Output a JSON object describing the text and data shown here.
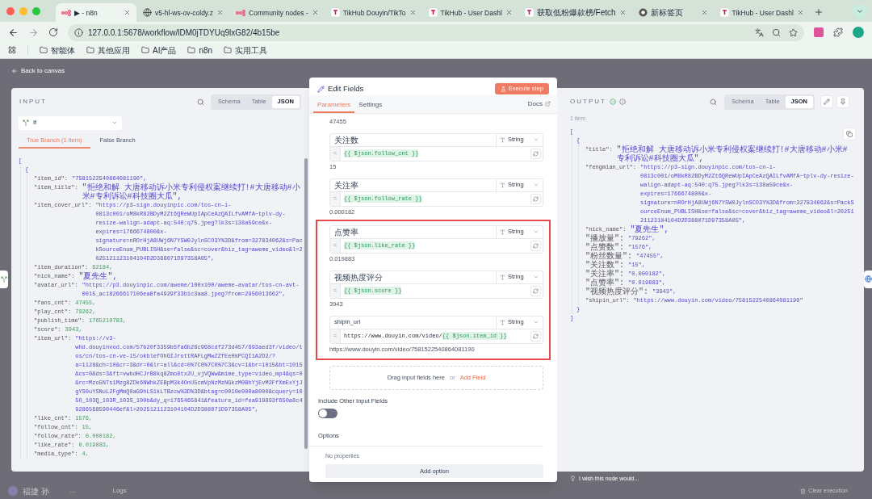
{
  "browser": {
    "tabs": [
      {
        "kind": "n8n",
        "title": "▶ - n8n",
        "selected": true
      },
      {
        "kind": "globe",
        "title": "v5-hl-ws-ov-coldy.z",
        "selected": false
      },
      {
        "kind": "n8n",
        "title": "Community nodes -",
        "selected": false
      },
      {
        "kind": "tikhub",
        "title": "TikHub Douyin/TikTo",
        "selected": false
      },
      {
        "kind": "tikhub",
        "title": "TikHub - User Dashl",
        "selected": false
      },
      {
        "kind": "tikhub",
        "title": "获取低粉爆款榜/Fetch",
        "selected": false
      },
      {
        "kind": "chrome",
        "title": "新标签页",
        "selected": false
      },
      {
        "kind": "tikhub",
        "title": "TikHub - User Dashl",
        "selected": false
      }
    ],
    "url": "127.0.0.1:5678/workflow/lDM0jTDYUq9lxG82/4b15be",
    "bookmarks": [
      "智能体",
      "其他应用",
      "AI产品",
      "n8n",
      "实用工具"
    ]
  },
  "back_link": "Back to canvas",
  "input": {
    "title": "INPUT",
    "views": [
      {
        "label": "Schema",
        "selected": false
      },
      {
        "label": "Table",
        "selected": false
      },
      {
        "label": "JSON",
        "selected": true
      }
    ],
    "node_select": "If",
    "branches": [
      {
        "label": "True Branch (1 item)",
        "selected": true
      },
      {
        "label": "False Branch",
        "selected": false
      }
    ],
    "json": {
      "open": "[",
      "items": [
        {
          "open": "{",
          "entries": [
            {
              "key": "\"item_id\":",
              "value": "\"7581522540864081190\",",
              "kind": "string"
            },
            {
              "key": "\"item_title\":",
              "value": "\"拒绝和解 大唐移动诉小米专利侵权案继续打!#大唐移动#小米#专利诉讼#科技圈大瓜\",",
              "kind": "string"
            },
            {
              "key": "\"item_cover_url\":",
              "value": "\"https://p3-sign.douyinpic.com/tos-cn-i-0813c001/oM8kR82BDyM2Zt6QReWUpIApCeAzQAILfvAMfA~tplv-dy-resize-walign-adapt-aq:540:q75.jpeg?lk3s=138a59ce&x-expires=1766674800&x-signature=nROrHjA8UWj6N7YSW0JylnSCO3Y%3D&from=327834062&s=PackSourceEnum_PUBLISH&se=false&sc=cover&biz_tag=aweme_video&l=2025121123104104D2D388071D97358A05\",",
              "kind": "string"
            },
            {
              "key": "\"item_duration\":",
              "value": "62184,",
              "kind": "number"
            },
            {
              "key": "\"nick_name\":",
              "value": "\"夏先生\",",
              "kind": "string"
            },
            {
              "key": "\"avatar_url\":",
              "value": "\"https://p3.douyinpic.com/aweme/100x100/aweme-avatar/tos-cn-avt-0015_ac18266617106ea8fa4929f33b1c3aa8.jpeg?from=2956013662\",",
              "kind": "string"
            },
            {
              "key": "\"fans_cnt\":",
              "value": "47455,",
              "kind": "number"
            },
            {
              "key": "\"play_cnt\":",
              "value": "79262,",
              "kind": "number"
            },
            {
              "key": "\"publish_time\":",
              "value": "1765210783,",
              "kind": "number"
            },
            {
              "key": "\"score\":",
              "value": "3943,",
              "kind": "number"
            },
            {
              "key": "\"item_url\":",
              "value": "\"https://v3-whd.douyinvod.com/57b20f3359b5fa6b28c968cdf273d457/693aed3f/video/tos/cn/tos-cn-ve-15/okblefOhGIJrottRAFLgMwZZfEeHkPCQI1A2D2/?a=1128&ch=10&cr=3&dr=0&lr=all&cd=0%7C0%7C0%7C3&cv=1&br=1015&bt=1015&cs=0&ds=3&ft=vwbdHCJrB8kq8Zmo8tx2U_vjVQWw&mime_type=video_mp4&qs=0&rc=Mzo5NTs1Mzg8ZDk6NWhkZEBpM3k4OnU5cmVpNzMzNGkzM0BhYjEvM2FfXmExYjJgYS0uYSNuL2FgMmQ0aG9hLS1kLTBzcw%3D%3D&btag=c0010e000a8000&cquery=105O_103Q_103R_103S_100b&dy_q=1765465841&feature_id=fea919893f650a8c49286568590446ef&l=2025121123104104D2D388071D97358A05\",",
              "kind": "string"
            },
            {
              "key": "\"like_cnt\":",
              "value": "1576,",
              "kind": "number"
            },
            {
              "key": "\"follow_cnt\":",
              "value": "15,",
              "kind": "number"
            },
            {
              "key": "\"follow_rate\":",
              "value": "0.000182,",
              "kind": "number"
            },
            {
              "key": "\"like_rate\":",
              "value": "0.019883,",
              "kind": "number"
            },
            {
              "key": "\"media_type\":",
              "value": "4,",
              "kind": "number"
            }
          ]
        }
      ]
    }
  },
  "editor": {
    "title": "Edit Fields",
    "execute_button": "Execute step",
    "tabs": [
      {
        "label": "Parameters",
        "selected": true
      },
      {
        "label": "Settings",
        "selected": false
      }
    ],
    "docs_link": "Docs",
    "fields": [
      {
        "kind": "partial",
        "result": "47455"
      },
      {
        "kind": "field",
        "name": "关注数",
        "type": "String",
        "prefix": "=",
        "expression": [
          {
            "kind": "expression",
            "text": "{{ $json.follow_cnt }}"
          }
        ],
        "result": "15",
        "highlighted": false
      },
      {
        "kind": "field",
        "name": "关注率",
        "type": "String",
        "prefix": "=",
        "expression": [
          {
            "kind": "expression",
            "text": "{{ $json.follow_rate }}"
          }
        ],
        "result": "0.000182",
        "highlighted": false
      },
      {
        "kind": "field",
        "name": "点赞率",
        "type": "String",
        "prefix": "=",
        "expression": [
          {
            "kind": "expression",
            "text": "{{ $json.like_rate }}"
          }
        ],
        "result": "0.019883",
        "highlighted": true
      },
      {
        "kind": "field",
        "name": "视频热度评分",
        "type": "String",
        "prefix": "=",
        "expression": [
          {
            "kind": "expression",
            "text": "{{ $json.score }}"
          }
        ],
        "result": "3943",
        "highlighted": true
      },
      {
        "kind": "field",
        "name": "shipin_url",
        "type": "String",
        "prefix": "=",
        "expression": [
          {
            "kind": "literal",
            "text": "https://www.douyin.com/video/"
          },
          {
            "kind": "expression",
            "text": "{{ $json.item_id }}"
          }
        ],
        "result": "https://www.douyin.com/video/7581522540864081190",
        "highlighted": true
      }
    ],
    "drop_zone": {
      "text": "Drag input fields here",
      "or": "or",
      "link": "Add Field"
    },
    "include_other": {
      "label": "Include Other Input Fields",
      "on": false
    },
    "options": {
      "title": "Options",
      "empty": "No properties",
      "button": "Add option"
    }
  },
  "output": {
    "title": "OUTPUT",
    "views": [
      {
        "label": "Schema",
        "selected": false
      },
      {
        "label": "Table",
        "selected": false
      },
      {
        "label": "JSON",
        "selected": true
      }
    ],
    "count": "1 item",
    "json": {
      "open": "[",
      "close": "]",
      "items": [
        {
          "open": "{",
          "close": "}",
          "entries": [
            {
              "key": "\"title\":",
              "value": "\"拒绝和解 大唐移动诉小米专利侵权案继续打!#大唐移动#小米#专利诉讼#科技圈大瓜\",",
              "kind": "string"
            },
            {
              "key": "\"fengmian_url\":",
              "value": "\"https://p3-sign.douyinpic.com/tos-cn-i-0813c001/oM8kR82BDyM2Zt6QReWUpIApCeAzQAILfvAMfA~tplv-dy-resize-walign-adapt-aq:540:q75.jpeg?lk3s=138a59ce&x-expires=1766674800&x-signature=nROrHjA8UWj6N7YSW0JylnSCO3Y%3D&from=327834062&s=PackSourceEnum_PUBLISH&se=false&sc=cover&biz_tag=aweme_video&l=2025121123104104D2D388071D97358A05\",",
              "kind": "string"
            },
            {
              "key": "\"nick_name\":",
              "value": "\"夏先生\",",
              "kind": "string"
            },
            {
              "key": "\"播放量\":",
              "value": "\"79262\",",
              "kind": "string"
            },
            {
              "key": "\"点赞数\":",
              "value": "\"1576\",",
              "kind": "string"
            },
            {
              "key": "\"粉丝数量\":",
              "value": "\"47455\",",
              "kind": "string"
            },
            {
              "key": "\"关注数\":",
              "value": "\"15\",",
              "kind": "string"
            },
            {
              "key": "\"关注率\":",
              "value": "\"0.000182\",",
              "kind": "string"
            },
            {
              "key": "\"点赞率\":",
              "value": "\"0.019883\",",
              "kind": "string"
            },
            {
              "key": "\"视频热度评分\":",
              "value": "\"3943\",",
              "kind": "string"
            },
            {
              "key": "\"shipin_url\":",
              "value": "\"https://www.douyin.com/video/7581522540864081190\"",
              "kind": "string"
            }
          ]
        }
      ]
    },
    "feedback": "I wish this node would..."
  },
  "footer": {
    "user": "福捷 孙",
    "menu": "...",
    "logs": "Logs",
    "clear": "Clear execution"
  }
}
